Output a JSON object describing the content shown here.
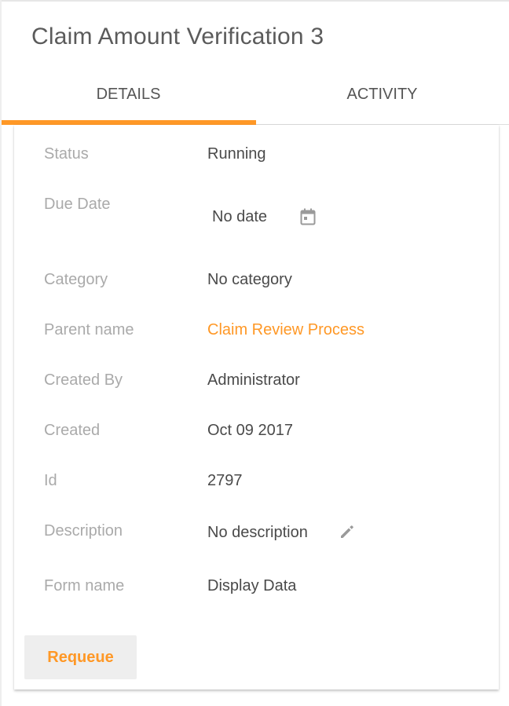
{
  "header": {
    "title": "Claim Amount Verification 3"
  },
  "tabs": [
    {
      "label": "DETAILS",
      "active": true
    },
    {
      "label": "ACTIVITY",
      "active": false
    }
  ],
  "accent_color": "#ff9826",
  "details": {
    "status": {
      "label": "Status",
      "value": "Running"
    },
    "due_date": {
      "label": "Due Date",
      "value": "No date",
      "icon": "calendar-icon"
    },
    "category": {
      "label": "Category",
      "value": "No category"
    },
    "parent_name": {
      "label": "Parent name",
      "value": "Claim Review Process"
    },
    "created_by": {
      "label": "Created By",
      "value": "Administrator"
    },
    "created": {
      "label": "Created",
      "value": "Oct 09 2017"
    },
    "id": {
      "label": "Id",
      "value": "2797"
    },
    "description": {
      "label": "Description",
      "value": "No description",
      "icon": "pencil-icon"
    },
    "form_name": {
      "label": "Form name",
      "value": "Display Data"
    }
  },
  "actions": {
    "requeue_label": "Requeue"
  }
}
